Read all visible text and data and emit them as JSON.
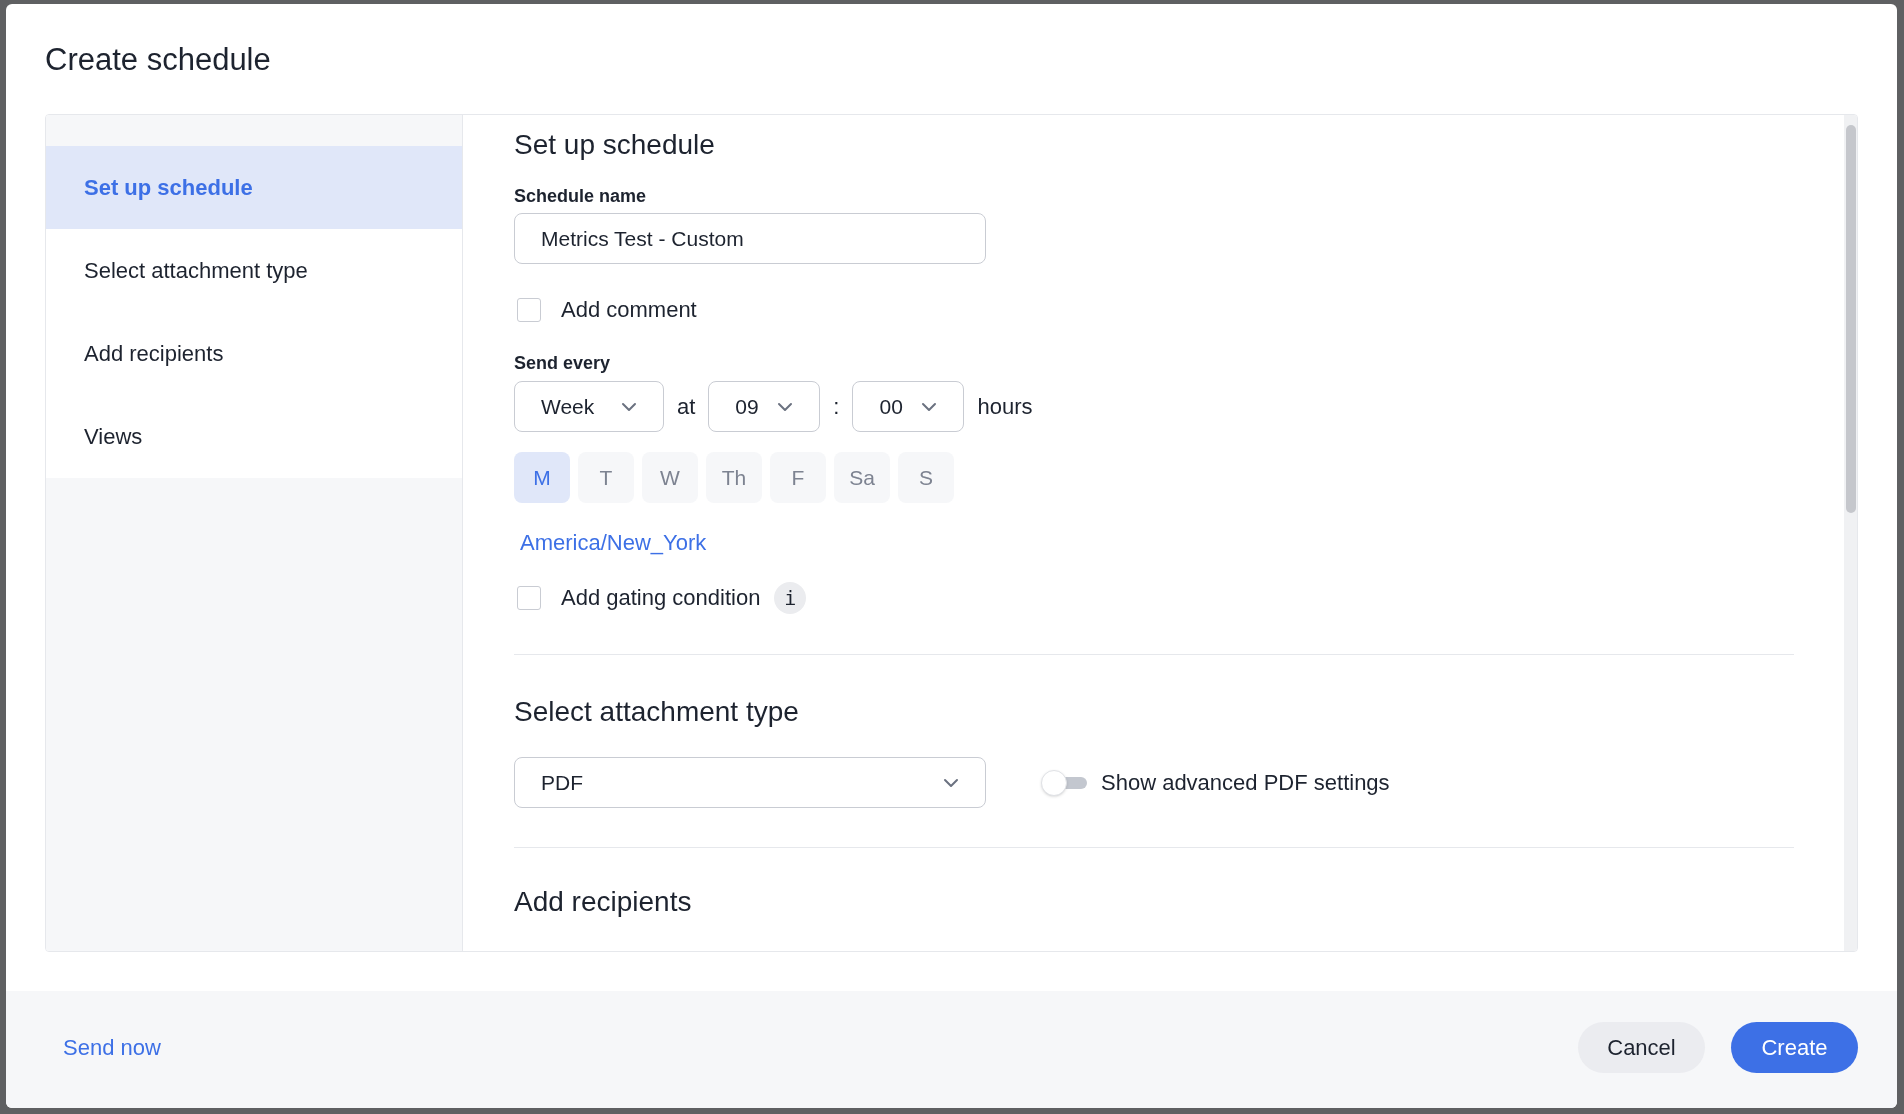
{
  "dialog": {
    "title": "Create schedule"
  },
  "sidebar": {
    "items": [
      {
        "label": "Set up schedule",
        "selected": true
      },
      {
        "label": "Select attachment type",
        "selected": false
      },
      {
        "label": "Add recipients",
        "selected": false
      },
      {
        "label": "Views",
        "selected": false
      }
    ]
  },
  "setup": {
    "heading": "Set up schedule",
    "name_label": "Schedule name",
    "name_value": "Metrics Test - Custom",
    "comment": {
      "label": "Add comment",
      "checked": false
    },
    "send_every_label": "Send every",
    "frequency": {
      "value": "Week"
    },
    "at_label": "at",
    "hour": {
      "value": "09"
    },
    "separator": ":",
    "minute": {
      "value": "00"
    },
    "hours_label": "hours",
    "days": [
      {
        "label": "M",
        "selected": true
      },
      {
        "label": "T",
        "selected": false
      },
      {
        "label": "W",
        "selected": false
      },
      {
        "label": "Th",
        "selected": false
      },
      {
        "label": "F",
        "selected": false
      },
      {
        "label": "Sa",
        "selected": false
      },
      {
        "label": "S",
        "selected": false
      }
    ],
    "timezone": "America/New_York",
    "gating": {
      "label": "Add gating condition",
      "checked": false,
      "info_icon": "i"
    }
  },
  "attachment": {
    "heading": "Select attachment type",
    "type": {
      "value": "PDF"
    },
    "advanced": {
      "label": "Show advanced PDF settings",
      "on": false
    }
  },
  "recipients": {
    "heading": "Add recipients"
  },
  "footer": {
    "send_now": "Send now",
    "cancel": "Cancel",
    "create": "Create"
  }
}
